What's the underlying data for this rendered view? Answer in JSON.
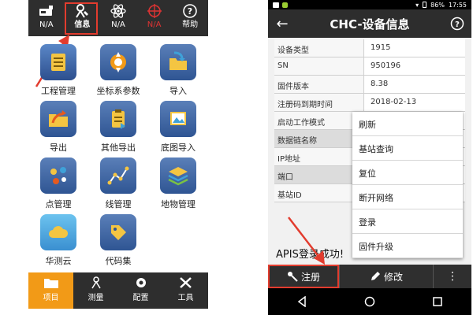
{
  "left": {
    "topbar": [
      {
        "label": "N/A",
        "icon": "receiver-icon"
      },
      {
        "label": "信息",
        "icon": "info-person-icon",
        "active": true
      },
      {
        "label": "N/A",
        "icon": "atom-icon"
      },
      {
        "label": "N/A",
        "icon": "crosshair-icon",
        "color": "#d33"
      },
      {
        "label": "帮助",
        "icon": "help-icon"
      }
    ],
    "grid": [
      {
        "label": "工程管理",
        "icon": "notebook-icon"
      },
      {
        "label": "坐标系参数",
        "icon": "coordinate-icon"
      },
      {
        "label": "导入",
        "icon": "import-folder-icon"
      },
      {
        "label": "导出",
        "icon": "export-folder-icon"
      },
      {
        "label": "其他导出",
        "icon": "clipboard-export-icon"
      },
      {
        "label": "底图导入",
        "icon": "image-import-icon"
      },
      {
        "label": "点管理",
        "icon": "points-icon"
      },
      {
        "label": "线管理",
        "icon": "polyline-icon"
      },
      {
        "label": "地物管理",
        "icon": "layers-icon"
      },
      {
        "label": "华测云",
        "icon": "cloud-icon"
      },
      {
        "label": "代码集",
        "icon": "tags-icon"
      }
    ],
    "bottomnav": [
      {
        "label": "项目",
        "icon": "folder-icon",
        "active": true
      },
      {
        "label": "测量",
        "icon": "survey-icon"
      },
      {
        "label": "配置",
        "icon": "gear-icon"
      },
      {
        "label": "工具",
        "icon": "tools-icon"
      }
    ],
    "accent": "#f29a17",
    "highlight_color": "#e23c2e"
  },
  "right": {
    "status": {
      "battery": "86%",
      "time": "17:55"
    },
    "title": "CHC-设备信息",
    "rows": [
      {
        "key": "设备类型",
        "value": "1915"
      },
      {
        "key": "SN",
        "value": "950196"
      },
      {
        "key": "固件版本",
        "value": "8.38"
      },
      {
        "key": "注册码到期时间",
        "value": "2018-02-13"
      },
      {
        "key": "启动工作模式",
        "value": ""
      },
      {
        "key": "数据链名称",
        "value": ""
      },
      {
        "key": "IP地址",
        "value": ""
      },
      {
        "key": "端口",
        "value": ""
      },
      {
        "key": "基站ID",
        "value": ""
      }
    ],
    "menu": [
      "刷新",
      "基站查询",
      "复位",
      "断开网络",
      "登录",
      "固件升级"
    ],
    "toast": "APIS登录成功!",
    "actions": {
      "register": "注册",
      "edit": "修改"
    }
  }
}
